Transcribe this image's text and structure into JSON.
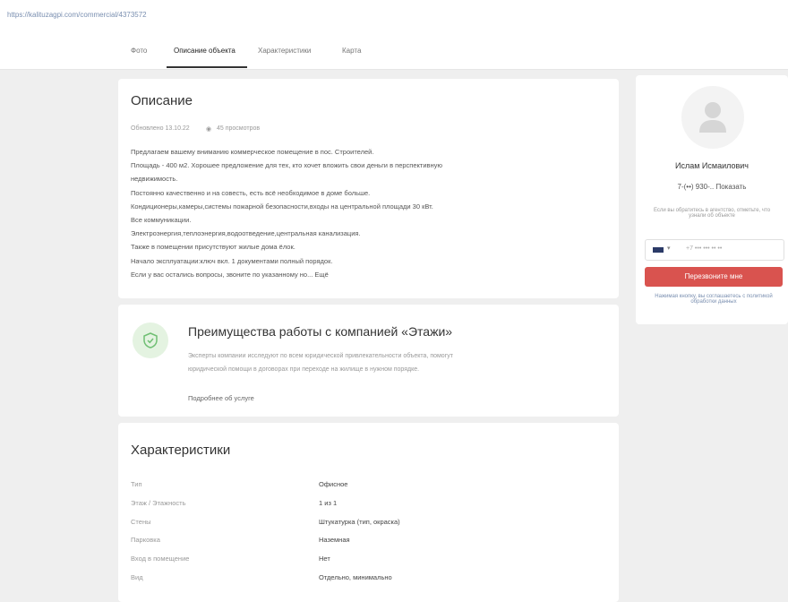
{
  "browser": {
    "url": "https://kalituzagpi.com/commercial/4373572"
  },
  "tabs": [
    {
      "label": "Фото"
    },
    {
      "label": "Описание объекта"
    },
    {
      "label": "Характеристики"
    },
    {
      "label": "Карта"
    }
  ],
  "description": {
    "title": "Описание",
    "date": "Обновлено 13.10.22",
    "views": "45 просмотров",
    "lines": [
      "Предлагаем вашему вниманию коммерческое помещение в пос. Строителей.",
      "Площадь - 400 м2. Хорошее предложение для тех, кто хочет вложить свои деньги в перспективную",
      "недвижимость.",
      "Постоянно качественно и на совесть, есть всё необходимое в доме больше.",
      "Кондиционеры,камеры,системы пожарной безопасности,входы на центральной площади 30 кВт.",
      "Все коммуникации.",
      "Электроэнергия,теплоэнергия,водоотведение,центральная канализация.",
      "Также в помещении присутствуют жилые дома ёлок.",
      "Начало эксплуатации:ключ вкл. 1 документами полный порядок.",
      "Если у вас остались вопросы, звоните по указанному но... Ещё"
    ]
  },
  "advantages": {
    "title": "Преимущества работы с компанией «Этажи»",
    "text_lines": [
      "Эксперты компании исследуют по всем юридической привлекательности объекта, помогут",
      "юридической помощи в договорах при переходе на жилище в нужном порядке."
    ],
    "link": "Подробнее об услуге"
  },
  "characteristics": {
    "title": "Характеристики",
    "rows": [
      {
        "label": "Тип",
        "value": "Офисное"
      },
      {
        "label": "Этаж / Этажность",
        "value": "1 из 1"
      },
      {
        "label": "Стены",
        "value": "Штукатурка (тип, окраска)"
      },
      {
        "label": "Парковка",
        "value": "Наземная"
      },
      {
        "label": "Вход в помещение",
        "value": "Нет"
      },
      {
        "label": "Вид",
        "value": "Отдельно, минимально"
      }
    ]
  },
  "agent": {
    "name": "Ислам Исмаилович",
    "phone_masked": "7-(••) 930-.. Показать",
    "note": "Если вы обратитесь в агентство, отметьте, что узнали об объекте",
    "phone_placeholder": "+7 ••• ••• •• ••",
    "call_button": "Перезвоните мне",
    "legal": "Нажимая кнопку, вы соглашаетесь с политикой обработки данных"
  }
}
